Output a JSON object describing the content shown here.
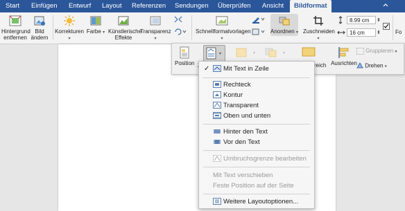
{
  "tabs": [
    "Start",
    "Einfügen",
    "Entwurf",
    "Layout",
    "Referenzen",
    "Sendungen",
    "Überprüfen",
    "Ansicht",
    "Bildformat"
  ],
  "active_tab": "Bildformat",
  "ribbon": {
    "remove_background": [
      "Hintergrund",
      "entfernen"
    ],
    "change_picture": [
      "Bild",
      "ändern"
    ],
    "corrections": "Korrekturen",
    "color": "Farbe",
    "artistic_effects": [
      "Künstlerische",
      "Effekte"
    ],
    "transparency": "Transparenz",
    "quick_styles": "Schnellformatvorlagen",
    "arrange": "Anordnen",
    "crop": "Zuschneiden",
    "height": "8.99 cm",
    "width": "16 cm",
    "format_pane": "Fo"
  },
  "arrange_panel": {
    "position": "Position",
    "wrap_text_partial": "Ze",
    "behind_partial": "reich",
    "align": "Ausrichten",
    "group": "Gruppieren",
    "rotate": "Drehen"
  },
  "wrap_menu": {
    "items": [
      {
        "label": "Mit Text in Zeile",
        "checked": true,
        "disabled": false,
        "icon": "wrap-inline-icon"
      },
      {
        "label": "Rechteck",
        "checked": false,
        "disabled": false,
        "icon": "wrap-square-icon"
      },
      {
        "label": "Kontur",
        "checked": false,
        "disabled": false,
        "icon": "wrap-tight-icon"
      },
      {
        "label": "Transparent",
        "checked": false,
        "disabled": false,
        "icon": "wrap-through-icon"
      },
      {
        "label": "Oben und unten",
        "checked": false,
        "disabled": false,
        "icon": "wrap-top-bottom-icon"
      },
      {
        "label": "Hinter den Text",
        "checked": false,
        "disabled": false,
        "icon": "wrap-behind-icon"
      },
      {
        "label": "Vor den Text",
        "checked": false,
        "disabled": false,
        "icon": "wrap-front-icon"
      },
      {
        "label": "Umbruchsgrenze bearbeiten",
        "checked": false,
        "disabled": true,
        "icon": "edit-wrap-points-icon"
      },
      {
        "label": "Mit Text verschieben",
        "checked": false,
        "disabled": true,
        "icon": ""
      },
      {
        "label": "Feste Position auf der Seite",
        "checked": false,
        "disabled": true,
        "icon": ""
      },
      {
        "label": "Weitere Layoutoptionen...",
        "checked": false,
        "disabled": false,
        "icon": "more-layout-options-icon"
      }
    ],
    "check_glyph": "✓"
  },
  "colors": {
    "tab_bar": "#2b579a",
    "ribbon": "#f3f3f3",
    "menu_bg": "#f6f6f6",
    "disabled_text": "#9a9a9a"
  }
}
